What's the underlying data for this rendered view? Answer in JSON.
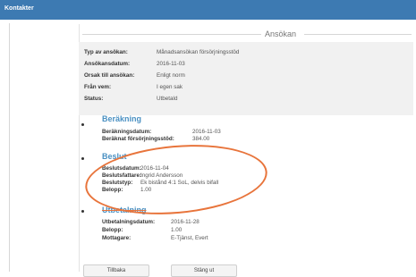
{
  "window": {
    "title": "Kontakter"
  },
  "application": {
    "heading": "Ansökan",
    "fields": [
      {
        "label": "Typ av ansökan:",
        "value": "Månadsansökan försörjningsstöd"
      },
      {
        "label": "Ansökansdatum:",
        "value": "2016-11-03"
      },
      {
        "label": "Orsak till ansökan:",
        "value": "Enligt norm"
      },
      {
        "label": "Från vem:",
        "value": "I egen sak"
      },
      {
        "label": "Status:",
        "value": "Utbetald"
      }
    ]
  },
  "berakning": {
    "title": "Beräkning",
    "fields": [
      {
        "label": "Beräkningsdatum:",
        "value": "2016-11-03"
      },
      {
        "label": "Beräknat försörjningsstöd:",
        "value": "384.00"
      }
    ]
  },
  "beslut": {
    "title": "Beslut",
    "fields": [
      {
        "label": "Beslutsdatum:",
        "value": "2016-11-04"
      },
      {
        "label": "Beslutsfattare:",
        "value": "Ingrid Andersson"
      },
      {
        "label": "Beslutstyp:",
        "value": "Ek bistånd 4:1 SoL, delvis bifall"
      },
      {
        "label": "Belopp:",
        "value": "1.00"
      }
    ]
  },
  "utbetalning": {
    "title": "Utbetalning",
    "fields": [
      {
        "label": "Utbetalningsdatum:",
        "value": "2016-11-28"
      },
      {
        "label": "Belopp:",
        "value": "1.00"
      },
      {
        "label": "Mottagare:",
        "value": "E-Tjänst, Evert"
      }
    ]
  },
  "buttons": {
    "back": "Tillbaka",
    "close": "Stäng ut"
  },
  "colors": {
    "header": "#3d7ab2",
    "section_title": "#4a90c2",
    "highlight_circle": "#e8743b"
  }
}
